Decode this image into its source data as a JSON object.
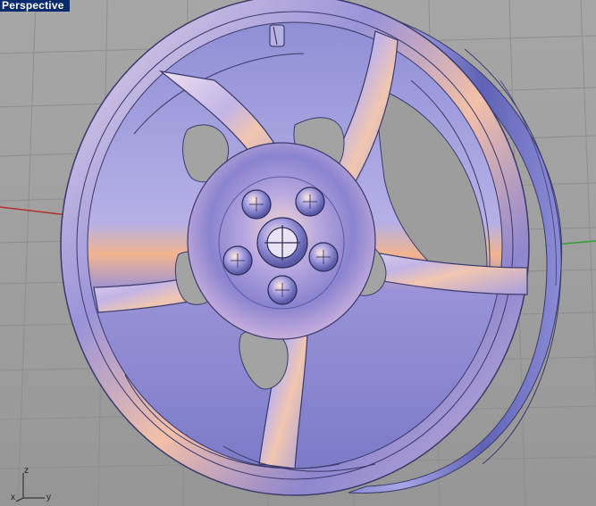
{
  "viewport": {
    "title": "Perspective",
    "background": "#9f9f9f",
    "title_bar_color": "#0a2a6e",
    "grid": true,
    "model": "wheel-rim"
  },
  "axes_widget": {
    "z_label": "z",
    "x_label": "x",
    "y_label": "y",
    "x_axis_color": "#b03030",
    "y_axis_color": "#30a030"
  }
}
